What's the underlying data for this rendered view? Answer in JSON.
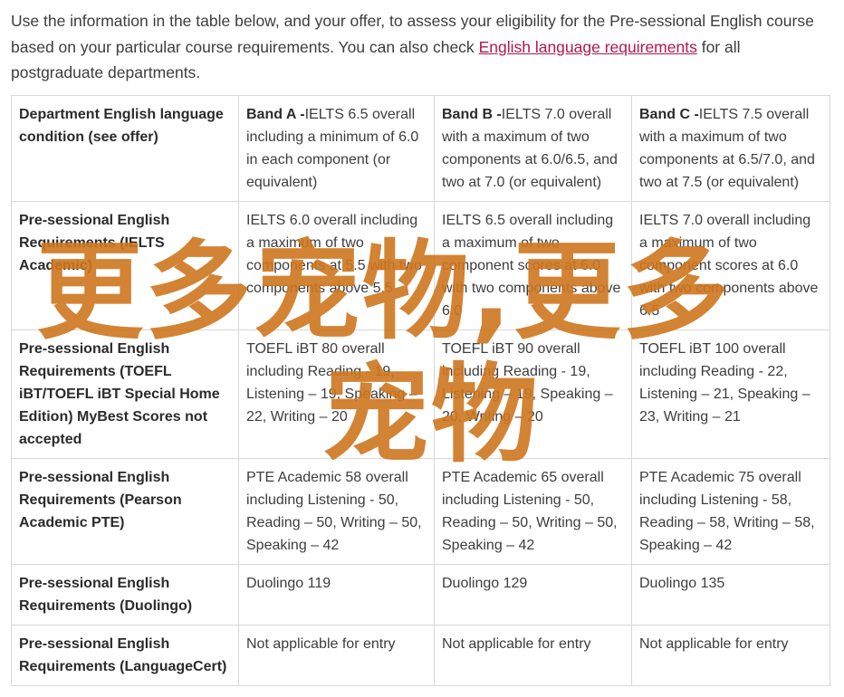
{
  "intro": {
    "before_link": "Use the information in the table below, and your offer, to assess your eligibility for the Pre-sessional English course based on your particular course requirements. You can also check ",
    "link": "English language requirements",
    "after_link": " for all postgraduate departments."
  },
  "table": {
    "header": {
      "col0": "Department English language condition (see offer)",
      "bands": [
        {
          "band": "Band A -",
          "text": "IELTS 6.5 overall including a minimum of 6.0 in each component (or equivalent)"
        },
        {
          "band": "Band B -",
          "text": "IELTS 7.0 overall with a maximum of two components at 6.0/6.5, and two at 7.0 (or equivalent)"
        },
        {
          "band": "Band C -",
          "text": "IELTS 7.5 overall with a maximum of two components at 6.5/7.0, and two at 7.5 (or equivalent)"
        }
      ]
    },
    "rows": [
      {
        "label": "Pre-sessional English Requirements (IELTS Academic)",
        "cells": [
          "IELTS 6.0 overall including a maximum of two components at 5.5 with two components above 5.5",
          "IELTS 6.5 overall including a maximum of two component scores at 6.0 with two components above 6.0",
          "IELTS 7.0 overall including a maximum of two component scores at 6.0 with two components above 6.5"
        ]
      },
      {
        "label": "Pre-sessional English Requirements (TOEFL iBT/TOEFL iBT Special Home Edition) MyBest Scores not accepted",
        "cells": [
          "TOEFL iBT 80 overall including Reading - 19, Listening – 19, Speaking – 22, Writing – 20",
          "TOEFL iBT 90 overall including Reading - 19, Listening – 19, Speaking – 20, Writing – 20",
          "TOEFL iBT 100 overall including Reading - 22, Listening – 21, Speaking – 23, Writing – 21"
        ]
      },
      {
        "label": "Pre-sessional English Requirements (Pearson Academic PTE)",
        "cells": [
          "PTE Academic 58 overall including Listening - 50, Reading – 50, Writing – 50, Speaking – 42",
          "PTE Academic 65 overall including Listening - 50, Reading – 50, Writing – 50, Speaking – 42",
          "PTE Academic 75 overall including Listening - 58, Reading – 58, Writing – 58, Speaking – 42"
        ]
      },
      {
        "label": "Pre-sessional English Requirements (Duolingo)",
        "cells": [
          "Duolingo 119",
          "Duolingo 129",
          "Duolingo 135"
        ]
      },
      {
        "label": "Pre-sessional English Requirements (LanguageCert)",
        "cells": [
          "Not applicable for entry",
          "Not applicable for entry",
          "Not applicable for entry"
        ]
      }
    ]
  },
  "watermark": {
    "line1": "更多宠物,更多",
    "line2": "宠物",
    "color": "#cd761e"
  }
}
